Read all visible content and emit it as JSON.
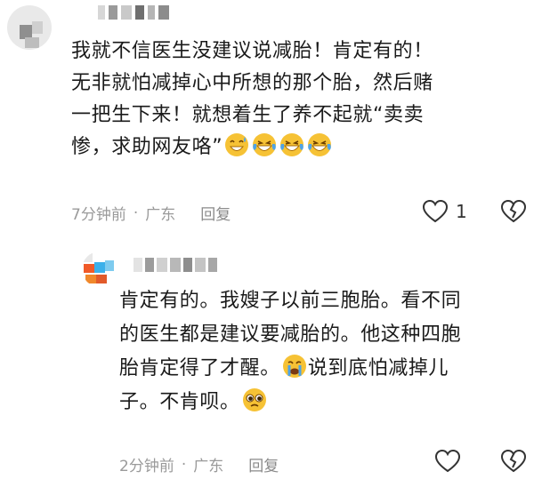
{
  "comments": [
    {
      "text": "我就不信医生没建议说减胎！肯定有的！\n无非就怕减掉心中所想的那个胎，然后赌\n一把生下来！就想着生了养不起就“卖卖\n惨，求助网友咯”",
      "emojis": [
        "grin-sweat-emoji",
        "crying-laughing-emoji",
        "crying-laughing-emoji",
        "crying-laughing-emoji"
      ],
      "time": "7分钟前",
      "location": "广东",
      "reply_label": "回复",
      "like_count": "1"
    },
    {
      "text_a": "肯定有的。我嫂子以前三胞胎。看不同\n的医生都是建议要减胎的。他这种四胞\n胎肯定得了才醒。",
      "text_b": "说到底怕减掉儿\n子。不肯呗。",
      "emojis": [
        "crying-face-emoji",
        "pleading-face-emoji"
      ],
      "time": "2分钟前",
      "location": "广东",
      "reply_label": "回复"
    }
  ],
  "colors": {
    "text": "#1a1a1a",
    "meta": "#9a9a9a",
    "emoji_yellow": "#f6c235",
    "tear_blue": "#4fa3e6"
  }
}
